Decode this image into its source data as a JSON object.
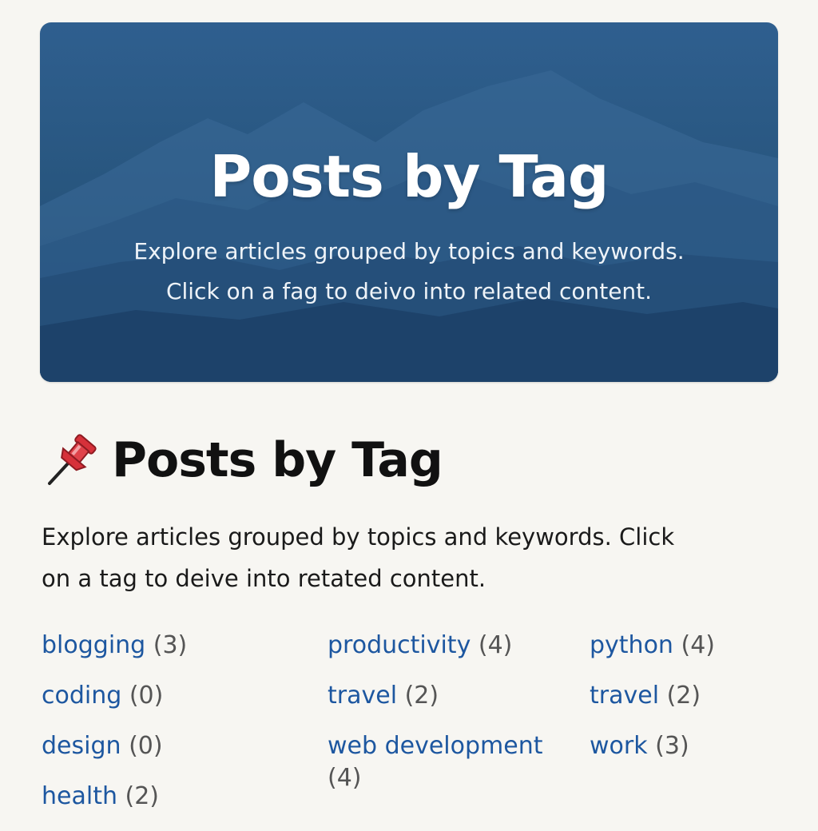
{
  "hero": {
    "title": "Posts by Tag",
    "subtitle_line1": "Explore articles grouped by topics and keywords.",
    "subtitle_line2": "Click on a fag to deivo into related content."
  },
  "heading": {
    "icon": "pushpin-icon",
    "title": "Posts by Tag"
  },
  "intro": {
    "line1": "Explore articles grouped by topics and keywords. Click",
    "line2": "on a tag to deive into retated content."
  },
  "tags": {
    "col1": [
      {
        "name": "blogging",
        "count": "(3)"
      },
      {
        "name": "coding",
        "count": "(0)"
      },
      {
        "name": "design",
        "count": "(0)"
      },
      {
        "name": "health",
        "count": "(2)"
      }
    ],
    "col2": [
      {
        "name": "productivity",
        "count": "(4)"
      },
      {
        "name": "travel",
        "count": "(2)"
      },
      {
        "name": "web development",
        "count": "(4)"
      }
    ],
    "col3": [
      {
        "name": "python",
        "count": "(4)"
      },
      {
        "name": "travel",
        "count": "(2)"
      },
      {
        "name": "work",
        "count": "(3)"
      }
    ]
  },
  "colors": {
    "hero_bg": "#28567f",
    "tag_link": "#1d57a0",
    "tag_count": "#555555",
    "page_bg": "#f7f6f2"
  }
}
